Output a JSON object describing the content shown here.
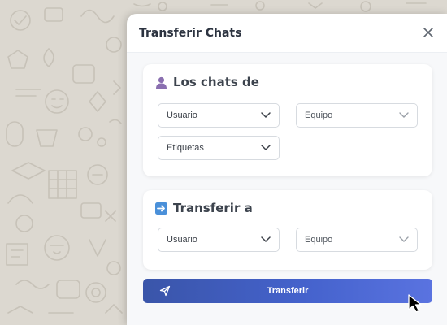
{
  "modal": {
    "title": "Transferir Chats",
    "close_icon": "close-icon"
  },
  "from_section": {
    "icon": "person-icon",
    "title": "Los chats de",
    "user_select": {
      "value": "Usuario"
    },
    "team_select": {
      "value": "Equipo"
    },
    "tags_select": {
      "value": "Etiquetas"
    }
  },
  "to_section": {
    "icon": "arrow-right-icon",
    "title": "Transferir a",
    "user_select": {
      "value": "Usuario"
    },
    "team_select": {
      "value": "Equipo"
    }
  },
  "transfer_button": {
    "label": "Transferir",
    "icon": "send-icon"
  },
  "colors": {
    "button_start": "#3a55a9",
    "button_end": "#5a73e0",
    "person_icon": "#8a6fb0",
    "arrow_icon": "#4a90d9"
  }
}
